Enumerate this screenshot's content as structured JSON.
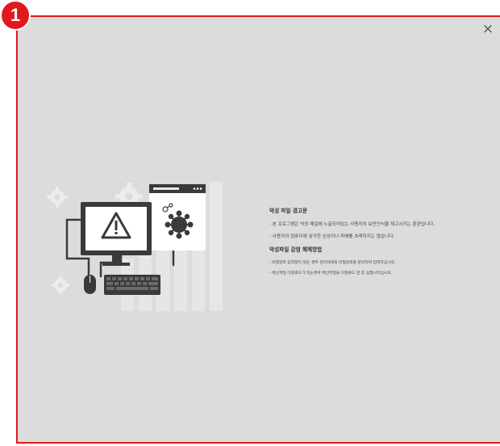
{
  "step_number": "1",
  "close_symbol": "×",
  "notice": {
    "title": "악성 파일 경고문",
    "lines": [
      "- 본 프로그램은 악성 메일에 노출되어있는 사용자의 보안인식을 제고시키는 훈련입니다.",
      "- 사용자의 컴퓨터에 심각한 손상이나 피해를 초래하지는 않습니다."
    ]
  },
  "fix": {
    "title": "악성파일 감염 해제방법",
    "lines": [
      "- 비밀번호 입력창이 있는 경우 관리자에게 비밀번호를 문의하여 입력하십시오.",
      "- 백신파일 다운로드가 있는경우 백신파일을 다운로드 한 후 실행시키십시오."
    ]
  },
  "icons": [
    "warning-icon",
    "virus-icon",
    "gear-icon",
    "monitor-icon",
    "keyboard-icon",
    "mouse-icon",
    "browser-window-icon"
  ],
  "colors": {
    "accent": "#e1191e",
    "panel_bg": "#dcdcdc",
    "illustration": "#3a3a3a"
  }
}
